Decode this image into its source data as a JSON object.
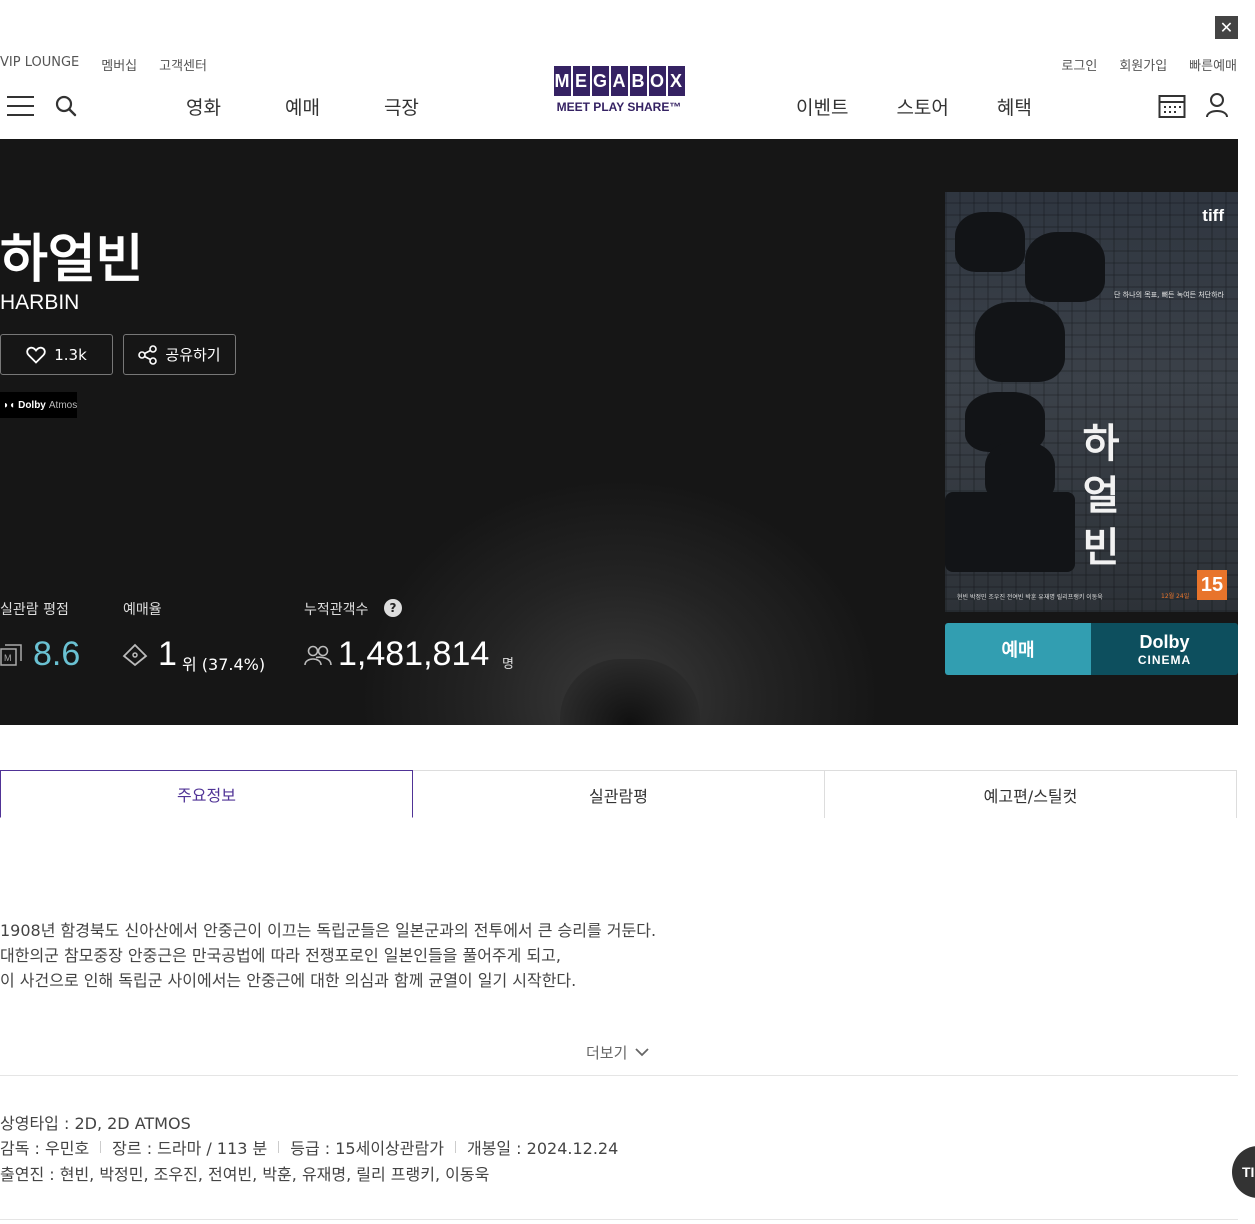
{
  "header": {
    "close_label": "✕",
    "util_left": [
      "VIP LOUNGE",
      "멤버십",
      "고객센터"
    ],
    "util_right": [
      "로그인",
      "회원가입",
      "빠른예매"
    ],
    "nav_left": [
      "영화",
      "예매",
      "극장"
    ],
    "nav_right": [
      "이벤트",
      "스토어",
      "혜택"
    ],
    "logo_letters": [
      "M",
      "E",
      "G",
      "A",
      "B",
      "O",
      "X"
    ],
    "logo_tagline": "MEET PLAY SHARE™",
    "icons": [
      "menu-icon",
      "search-icon",
      "calendar-icon",
      "user-icon"
    ]
  },
  "movie": {
    "title": "하얼빈",
    "title_en": "HARBIN",
    "like_count": "1.3k",
    "share_label": "공유하기",
    "format_badge": {
      "brand": "Dolby",
      "type": "Atmos"
    }
  },
  "stats": {
    "rating_label": "실관람 평점",
    "rating_value": "8.6",
    "rank_label": "예매율",
    "rank_value": "1",
    "rank_sub": "위 (37.4%)",
    "audience_label": "누적관객수",
    "audience_help": "?",
    "audience_value": "1,481,814",
    "audience_unit": "명"
  },
  "poster": {
    "festival": "tiff",
    "tagline": "단 하나의 목표, 뼈든 녹여든 처단하라",
    "title_chars": [
      "하",
      "얼",
      "빈"
    ],
    "rating": "15",
    "credits": "현빈 박정민 조우진 전여빈 박훈 유재명 릴리프랭키 이동욱",
    "release": "12월 24일"
  },
  "actions": {
    "book_label": "예매",
    "dolby_line1": "Dolby",
    "dolby_line2": "CINEMA"
  },
  "tabs": [
    "주요정보",
    "실관람평",
    "예고편/스틸컷"
  ],
  "synopsis": [
    "1908년 함경북도 신아산에서 안중근이 이끄는 독립군들은 일본군과의 전투에서 큰 승리를 거둔다.",
    "대한의군 참모중장 안중근은 만국공법에 따라 전쟁포로인 일본인들을 풀어주게 되고,",
    "이 사건으로 인해 독립군 사이에서는 안중근에 대한 의심과 함께 균열이 일기 시작한다."
  ],
  "more_label": "더보기",
  "info": {
    "screen_type": "상영타입 : 2D, 2D ATMOS",
    "director": "감독 : 우민호",
    "genre": "장르 : 드라마 / 113 분",
    "grade": "등급 : 15세이상관람가",
    "release": "개봉일 : 2024.12.24",
    "cast": "출연진 : 현빈, 박정민, 조우진, 전여빈, 박훈, 유재명, 릴리 프랭키, 이동욱"
  },
  "top_button": "TI",
  "colors": {
    "brand": "#352263",
    "accent": "#503396",
    "rating": "#6ac1d2",
    "book": "#329eb1",
    "dolby": "#0d4f5e"
  }
}
